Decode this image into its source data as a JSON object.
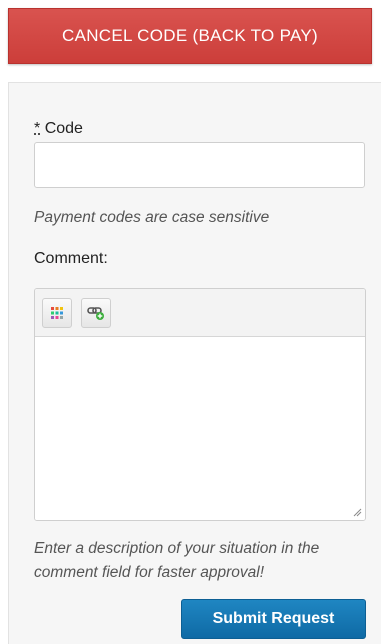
{
  "header": {
    "cancel_label": "CANCEL CODE (BACK TO PAY)"
  },
  "form": {
    "code_required_marker": "*",
    "code_label": "Code",
    "code_value": "",
    "code_hint": "Payment codes are case sensitive",
    "comment_label": "Comment:",
    "comment_value": "",
    "comment_hint": "Enter a description of your situation in the comment field for faster approval!",
    "submit_label": "Submit Request"
  },
  "editor_toolbar": {
    "buttons": [
      {
        "icon": "color-palette-icon"
      },
      {
        "icon": "insert-link-icon"
      }
    ]
  },
  "colors": {
    "cancel_bg": "#d9534f",
    "submit_bg": "#1679b6",
    "panel_bg": "#f6f6f6"
  }
}
